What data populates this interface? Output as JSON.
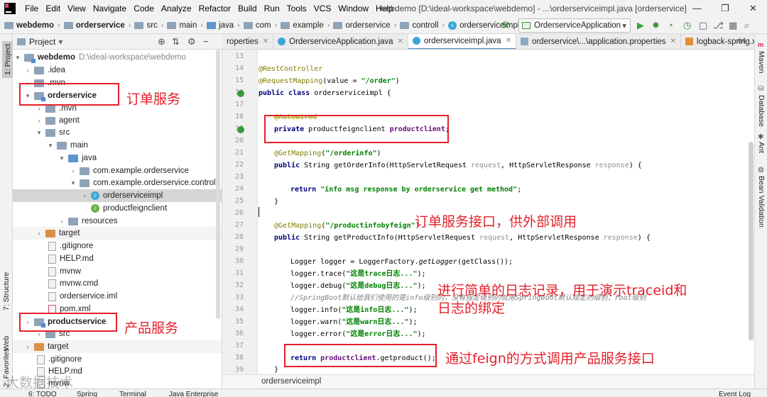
{
  "window": {
    "title": "webdemo [D:\\ideal-workspace\\webdemo] - ...\\orderserviceimpl.java [orderservice]",
    "controls": [
      "—",
      "❐",
      "✕"
    ]
  },
  "menu": [
    "File",
    "Edit",
    "View",
    "Navigate",
    "Code",
    "Analyze",
    "Refactor",
    "Build",
    "Run",
    "Tools",
    "VCS",
    "Window",
    "Help"
  ],
  "navbar": {
    "crumbs": [
      "webdemo",
      "orderservice",
      "src",
      "main",
      "java",
      "com",
      "example",
      "orderservice",
      "controll",
      "orderserviceimpl"
    ],
    "run_config": "OrderserviceApplication"
  },
  "left_strip": [
    "1: Project",
    "7: Structure",
    "Web",
    "2: Favorites"
  ],
  "project_panel": {
    "title": "Project",
    "tree": [
      {
        "label": "webdemo",
        "hint": "D:\\ideal-workspace\\webdemo",
        "bold": true
      },
      {
        "label": ".idea"
      },
      {
        "label": ".mvn"
      },
      {
        "label": "orderservice",
        "bold": true
      },
      {
        "label": ".mvn"
      },
      {
        "label": "agent"
      },
      {
        "label": "src"
      },
      {
        "label": "main"
      },
      {
        "label": "java"
      },
      {
        "label": "com.example.orderservice"
      },
      {
        "label": "com.example.orderservice.controll"
      },
      {
        "label": "orderserviceimpl"
      },
      {
        "label": "productfeignclient"
      },
      {
        "label": "resources"
      },
      {
        "label": "target"
      },
      {
        "label": ".gitignore"
      },
      {
        "label": "HELP.md"
      },
      {
        "label": "mvnw"
      },
      {
        "label": "mvnw.cmd"
      },
      {
        "label": "orderservice.iml"
      },
      {
        "label": "pom.xml"
      },
      {
        "label": "productservice",
        "bold": true
      },
      {
        "label": "src"
      },
      {
        "label": "target"
      },
      {
        "label": ".gitignore"
      },
      {
        "label": "HELP.md"
      },
      {
        "label": "mvnw"
      }
    ]
  },
  "editor": {
    "tabs": [
      {
        "label": "roperties"
      },
      {
        "label": "OrderserviceApplication.java"
      },
      {
        "label": "orderserviceimpl.java"
      },
      {
        "label": "orderservice\\...\\application.properties"
      },
      {
        "label": "logback-spring.xm"
      }
    ],
    "tab_menu": "≡4",
    "line_numbers": [
      "13",
      "14",
      "15",
      "16",
      "17",
      "18",
      "19",
      "20",
      "21",
      "22",
      "23",
      "24",
      "25",
      "26",
      "27",
      "28",
      "29",
      "30",
      "31",
      "32",
      "33",
      "34",
      "35",
      "36",
      "37",
      "38",
      "39"
    ],
    "bottom_breadcrumb": "orderserviceimpl",
    "code": {
      "l14": "@RestController",
      "l15a": "@RequestMapping",
      "l15b": "(value = ",
      "l15c": "\"/order\"",
      "l15d": ")",
      "l16a": "public class",
      "l16b": " orderserviceimpl {",
      "l18": "@Autowired",
      "l19a": "private",
      "l19b": " productfeignclient ",
      "l19c": "productclient",
      "l19d": ";",
      "l21a": "@GetMapping",
      "l21b": "(",
      "l21c": "\"/orderinfo\"",
      "l21d": ")",
      "l22a": "public",
      "l22b": " String getOrderInfo(HttpServletRequest ",
      "l22c": "request",
      "l22d": ", HttpServletResponse ",
      "l22e": "response",
      "l22f": ") {",
      "l24a": "return",
      "l24b": " ",
      "l24c": "\"info msg response by orderservice get method\"",
      "l24d": ";",
      "l25": "}",
      "l27a": "@GetMapping",
      "l27b": "(",
      "l27c": "\"/productinfobyfeign\"",
      "l27d": ")",
      "l28a": "public",
      "l28b": " String getProductInfo(HttpServletRequest ",
      "l28c": "request",
      "l28d": ", HttpServletResponse ",
      "l28e": "response",
      "l28f": ") {",
      "l30a": "Logger logger = LoggerFactory.",
      "l30b": "getLogger",
      "l30c": "(getClass());",
      "l31a": "logger.trace(",
      "l31b": "\"这是trace日志...\"",
      "l31c": ");",
      "l32a": "logger.debug(",
      "l32b": "\"这是debug日志...\"",
      "l32c": ");",
      "l33": "//SpringBoot默认给我们使用的是info级别的，没有指定级别的就用SpringBoot默认规定的级别；root级别",
      "l34a": "logger.info(",
      "l34b": "\"这是info日志...\"",
      "l34c": ");",
      "l35a": "logger.warn(",
      "l35b": "\"这是warn日志...\"",
      "l35c": ");",
      "l36a": "logger.error(",
      "l36b": "\"这是error日志...\"",
      "l36c": ");",
      "l38a": "return",
      "l38b": " ",
      "l38c": "productclient",
      "l38d": ".getproduct();",
      "l39": "}"
    }
  },
  "right_strip": [
    "Maven",
    "Database",
    "Ant",
    "Bean Validation"
  ],
  "annotations": {
    "order_service": "订单服务",
    "product_service": "产品服务",
    "order_api": "订单服务接口，供外部调用",
    "log_line1": "进行简单的日志记录，用于演示traceid和",
    "log_line2": "日志的绑定",
    "feign_call": "通过feign的方式调用产品服务接口"
  },
  "bottom_bar": [
    "6: TODO",
    "Spring",
    "Terminal",
    "Java Enterprise",
    "Event Log"
  ],
  "watermark": "大数据技术",
  "colors": {
    "annotation_red": "#e5202a",
    "keyword": "#000080",
    "string": "#008000",
    "annotation": "#808000",
    "field": "#660e7a"
  }
}
